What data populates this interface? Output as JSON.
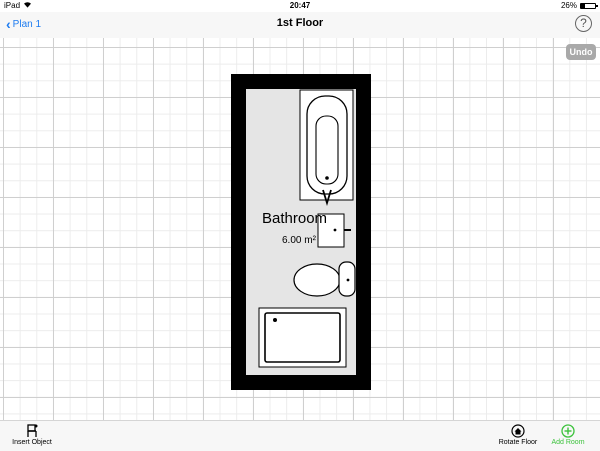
{
  "status_bar": {
    "device": "iPad",
    "time": "20:47",
    "battery": "26%",
    "battery_level": 0.26
  },
  "nav": {
    "back_label": "Plan 1",
    "title": "1st Floor",
    "help_label": "?"
  },
  "canvas": {
    "undo_label": "Undo",
    "room": {
      "name": "Bathroom",
      "area": "6.00 m²"
    }
  },
  "toolbar": {
    "insert_object": "Insert Object",
    "rotate_floor": "Rotate Floor",
    "add_room": "Add Room"
  },
  "colors": {
    "accent": "#1e7cf0",
    "add_green": "#3cc23c",
    "floor": "#e5e5e5",
    "wall": "#000000"
  }
}
